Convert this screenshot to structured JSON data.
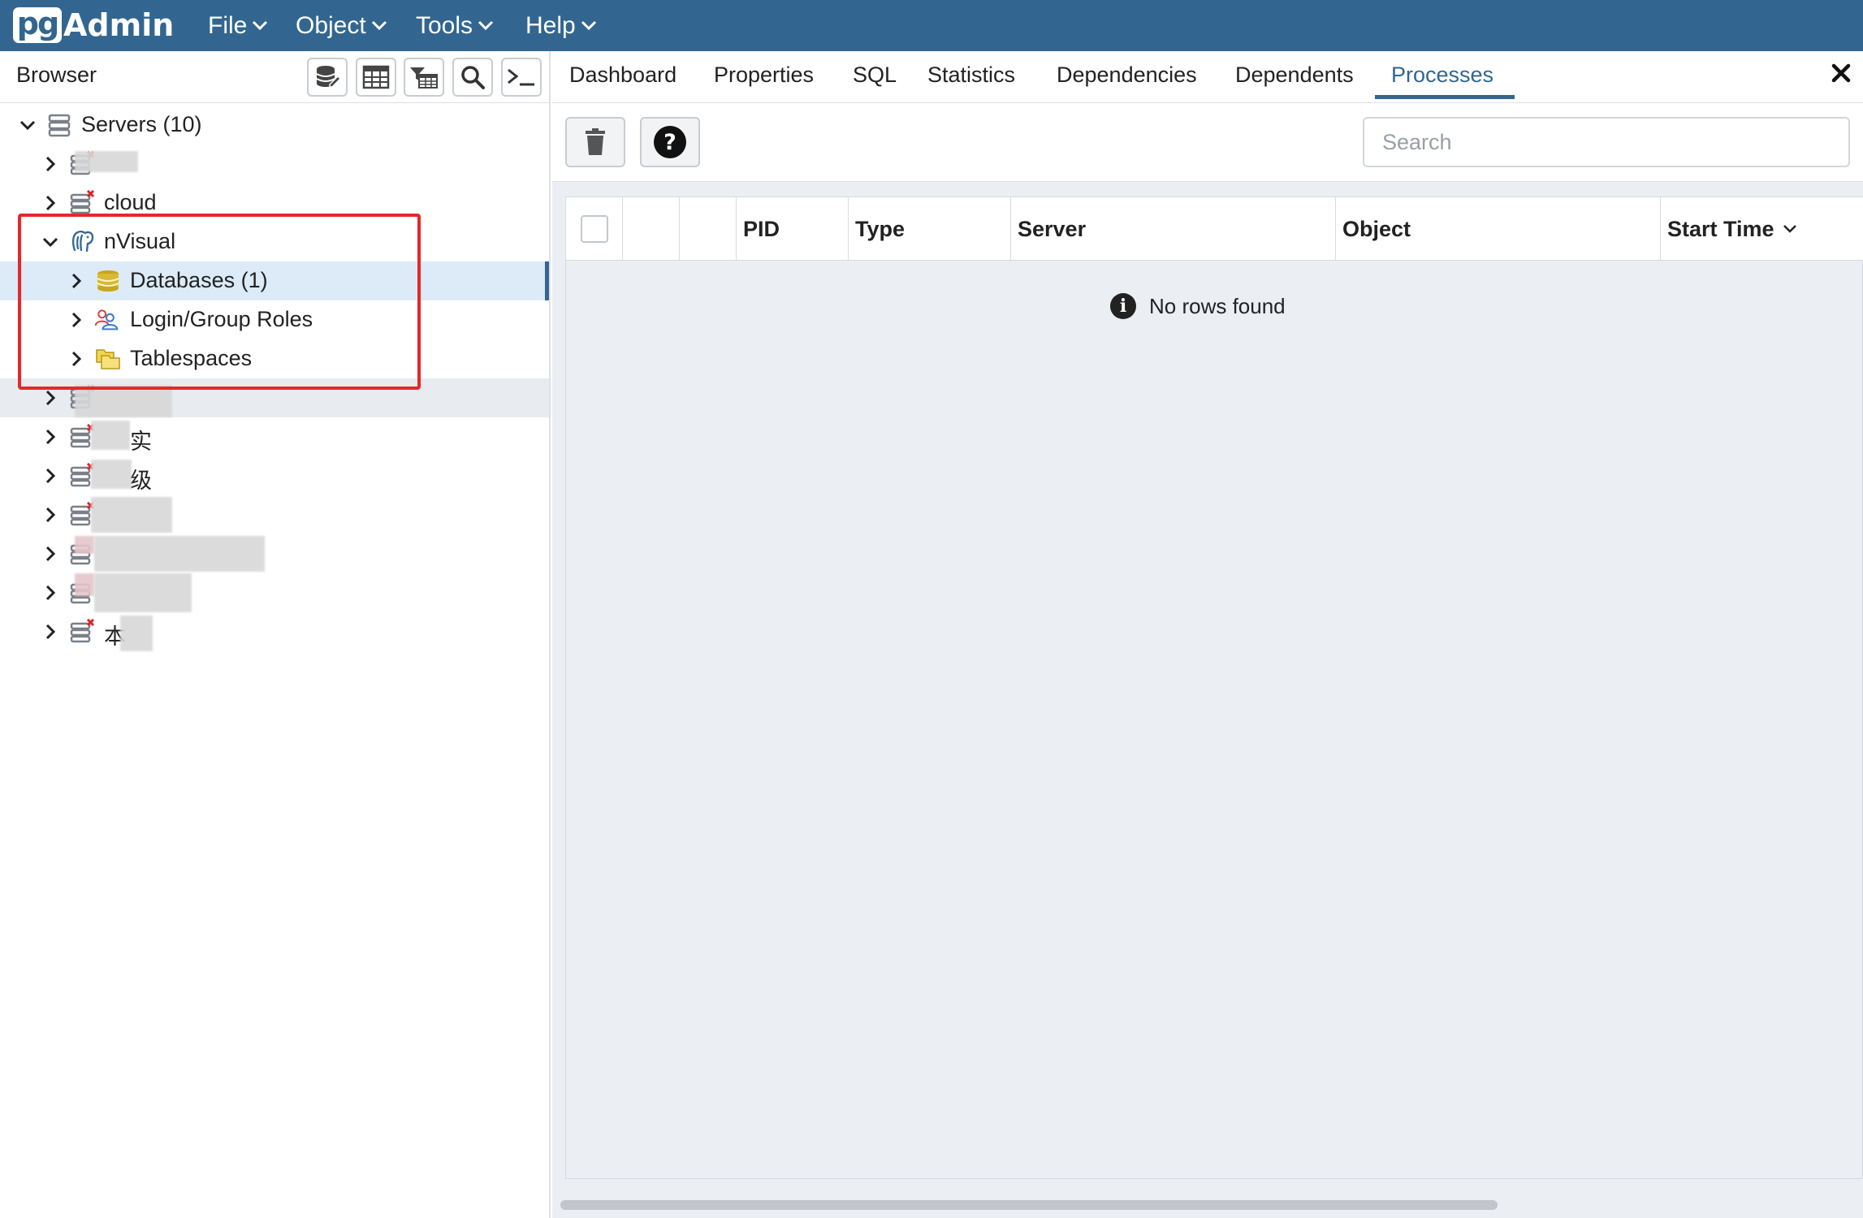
{
  "app": {
    "logo_pg": "pg",
    "logo_admin": "Admin",
    "menu": [
      {
        "label": "File"
      },
      {
        "label": "Object"
      },
      {
        "label": "Tools"
      },
      {
        "label": "Help"
      }
    ]
  },
  "browser": {
    "title": "Browser",
    "toolbar": [
      "query-tool-icon",
      "view-data-icon",
      "filtered-rows-icon",
      "search-objects-icon",
      "psql-tool-icon"
    ]
  },
  "tree": {
    "root": {
      "label": "Servers (10)",
      "expanded": true
    },
    "servers": [
      {
        "label": "",
        "status": "disconnected"
      },
      {
        "label": "cloud",
        "status": "disconnected"
      },
      {
        "label": "nVisual",
        "status": "connected",
        "expanded": true,
        "children": [
          {
            "label": "Databases (1)",
            "icon": "databases-icon",
            "selected": true
          },
          {
            "label": "Login/Group Roles",
            "icon": "login-roles-icon"
          },
          {
            "label": "Tablespaces",
            "icon": "tablespaces-icon"
          }
        ]
      },
      {
        "label": "",
        "status": "disconnected"
      },
      {
        "label": "实",
        "status": "disconnected"
      },
      {
        "label": "级",
        "status": "disconnected"
      },
      {
        "label": "",
        "status": "disconnected"
      },
      {
        "label": "",
        "status": "disconnected"
      },
      {
        "label": "",
        "status": "disconnected"
      },
      {
        "label": "本",
        "status": "disconnected"
      }
    ]
  },
  "tabs": [
    {
      "label": "Dashboard"
    },
    {
      "label": "Properties"
    },
    {
      "label": "SQL"
    },
    {
      "label": "Statistics"
    },
    {
      "label": "Dependencies"
    },
    {
      "label": "Dependents"
    },
    {
      "label": "Processes",
      "active": true
    }
  ],
  "processes": {
    "search_placeholder": "Search",
    "columns": [
      "PID",
      "Type",
      "Server",
      "Object",
      "Start Time"
    ],
    "sort_column": "Start Time",
    "empty_message": "No rows found"
  },
  "colors": {
    "brand": "#326690",
    "highlight_box": "#e8272a",
    "selected_row": "#dcebf7"
  }
}
